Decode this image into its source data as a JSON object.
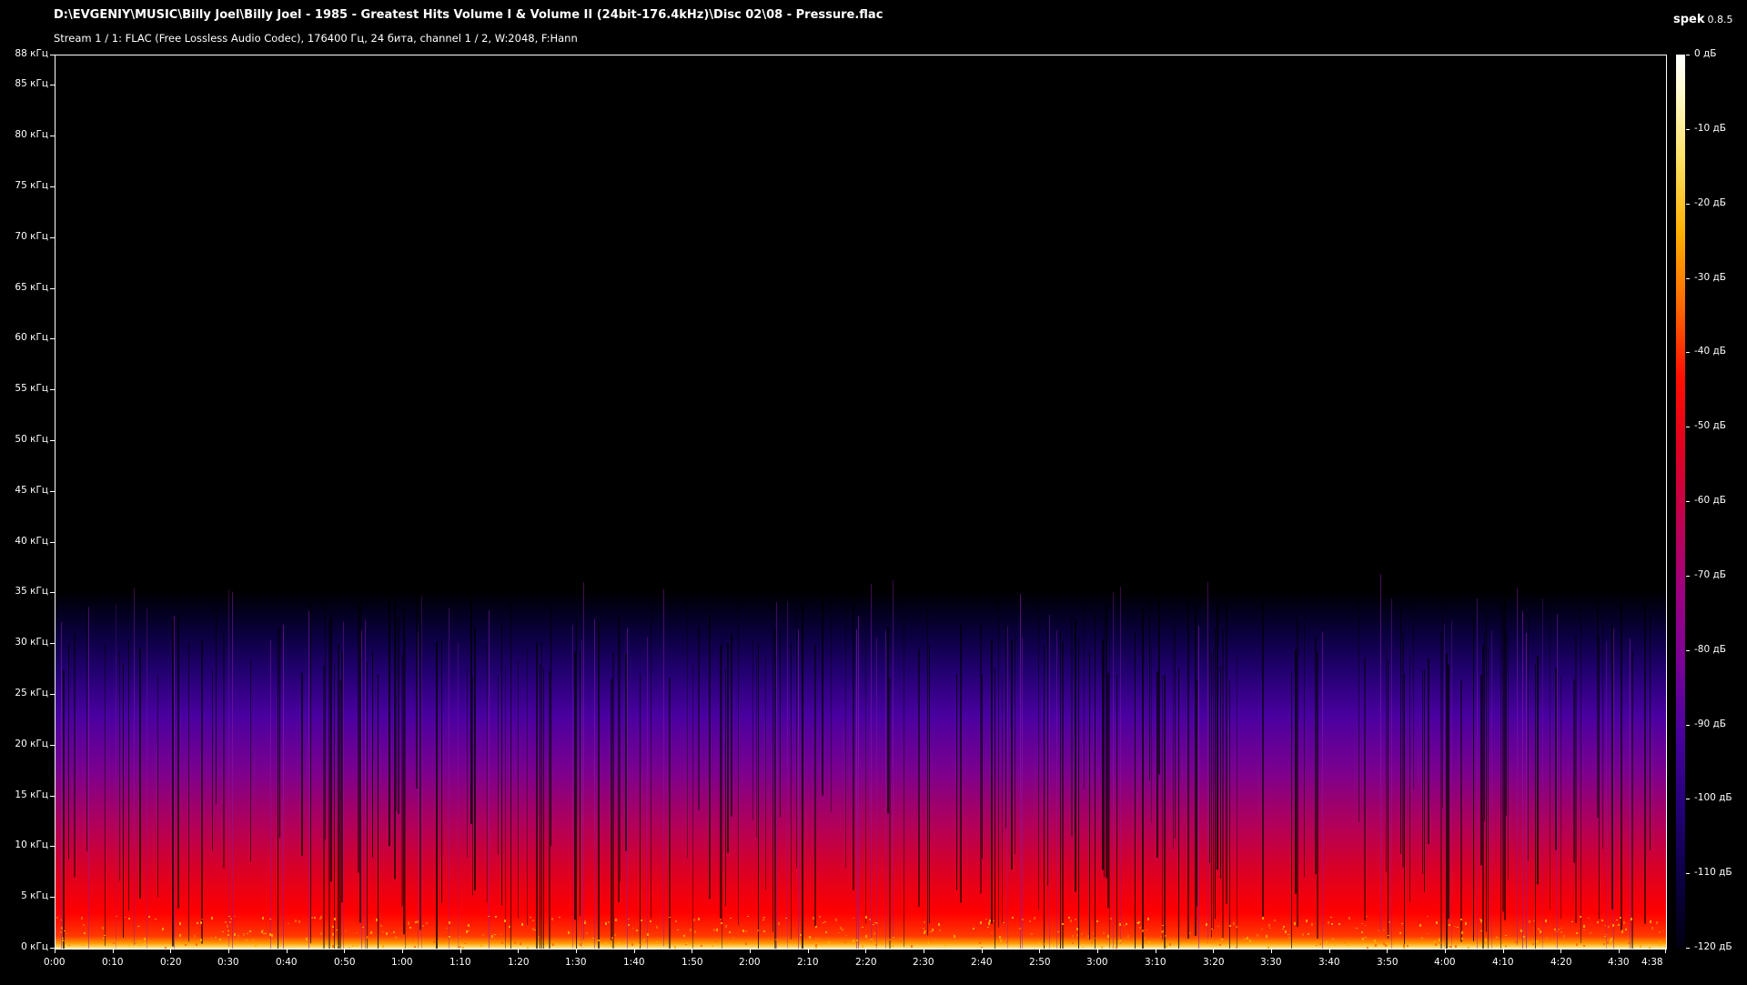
{
  "window": {
    "title": "D:\\EVGENIY\\MUSIC\\Billy Joel\\Billy Joel - 1985 - Greatest Hits Volume I & Volume II (24bit-176.4kHz)\\Disc 02\\08 - Pressure.flac",
    "subtitle": "Stream 1 / 1: FLAC (Free Lossless Audio Codec), 176400 Гц, 24 бита, channel 1 / 2, W:2048, F:Hann",
    "app_name": "spek",
    "app_version": "0.8.5"
  },
  "plot": {
    "y_ticks": [
      "0 кГц",
      "5 кГц",
      "10 кГц",
      "15 кГц",
      "20 кГц",
      "25 кГц",
      "30 кГц",
      "35 кГц",
      "40 кГц",
      "45 кГц",
      "50 кГц",
      "55 кГц",
      "60 кГц",
      "65 кГц",
      "70 кГц",
      "75 кГц",
      "80 кГц",
      "85 кГц",
      "88 кГц"
    ],
    "y_tick_values_khz": [
      0,
      5,
      10,
      15,
      20,
      25,
      30,
      35,
      40,
      45,
      50,
      55,
      60,
      65,
      70,
      75,
      80,
      85,
      88
    ],
    "y_max_khz": 88,
    "x_ticks": [
      "0:00",
      "0:10",
      "0:20",
      "0:30",
      "0:40",
      "0:50",
      "1:00",
      "1:10",
      "1:20",
      "1:30",
      "1:40",
      "1:50",
      "2:00",
      "2:10",
      "2:20",
      "2:30",
      "2:40",
      "2:50",
      "3:00",
      "3:10",
      "3:20",
      "3:30",
      "3:40",
      "3:50",
      "4:00",
      "4:10",
      "4:20",
      "4:30",
      "4:38"
    ],
    "x_tick_values_sec": [
      0,
      10,
      20,
      30,
      40,
      50,
      60,
      70,
      80,
      90,
      100,
      110,
      120,
      130,
      140,
      150,
      160,
      170,
      180,
      190,
      200,
      210,
      220,
      230,
      240,
      250,
      260,
      270,
      278
    ],
    "x_max_sec": 278
  },
  "colorbar": {
    "ticks": [
      "0 дБ",
      "-10 дБ",
      "-20 дБ",
      "-30 дБ",
      "-40 дБ",
      "-50 дБ",
      "-60 дБ",
      "-70 дБ",
      "-80 дБ",
      "-90 дБ",
      "-100 дБ",
      "-110 дБ",
      "-120 дБ"
    ],
    "range_db": [
      0,
      -120
    ]
  }
}
